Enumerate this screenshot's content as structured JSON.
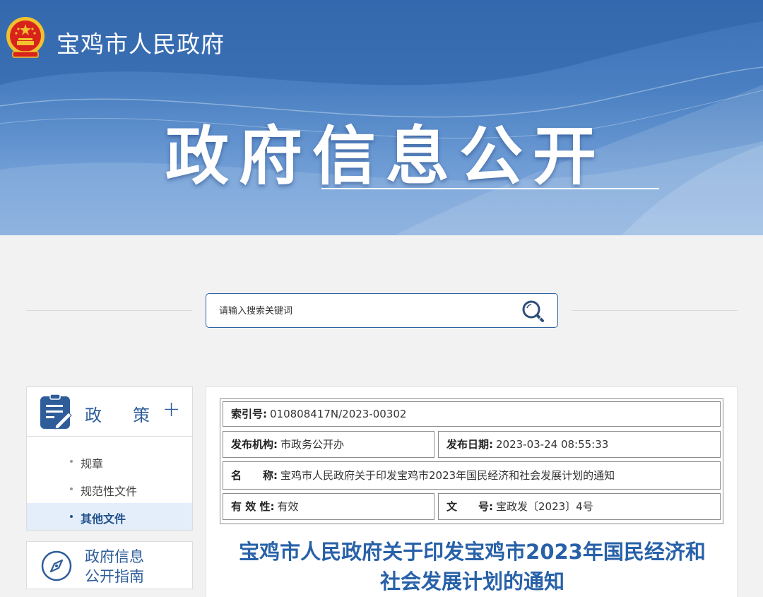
{
  "site": {
    "name": "宝鸡市人民政府",
    "emblem_icon": "national-emblem-icon"
  },
  "banner": {
    "title": "政府信息公开"
  },
  "search": {
    "placeholder": "请输入搜索关键词",
    "icon": "search-icon"
  },
  "sidebar": {
    "heading_part1": "政",
    "heading_part2": "策",
    "heading_icon": "document-edit-icon",
    "expand_symbol": "+",
    "items": [
      {
        "label": "规章",
        "active": false
      },
      {
        "label": "规范性文件",
        "active": false
      },
      {
        "label": "其他文件",
        "active": true
      }
    ],
    "guide": {
      "line1": "政府信息",
      "line2": "公开指南",
      "icon": "compass-icon"
    }
  },
  "meta": {
    "index_label": "索引号:",
    "index_value": "010808417N/2023-00302",
    "publisher_label": "发布机构:",
    "publisher_value": "市政务公开办",
    "date_label": "发布日期:",
    "date_value": "2023-03-24 08:55:33",
    "name_label": "名　　称:",
    "name_value": "宝鸡市人民政府关于印发宝鸡市2023年国民经济和社会发展计划的通知",
    "validity_label": "有 效 性:",
    "validity_value": "有效",
    "docno_label": "文　　号:",
    "docno_value": "宝政发〔2023〕4号"
  },
  "document": {
    "title_line1": "宝鸡市人民政府关于印发宝鸡市2023年国民经济和",
    "title_line2": "社会发展计划的通知"
  },
  "colors": {
    "banner_blue": "#3b70b6",
    "accent_blue": "#2e5d9a",
    "title_blue": "#2861a8",
    "emblem_red": "#d8231c",
    "emblem_gold": "#f2c12e"
  }
}
